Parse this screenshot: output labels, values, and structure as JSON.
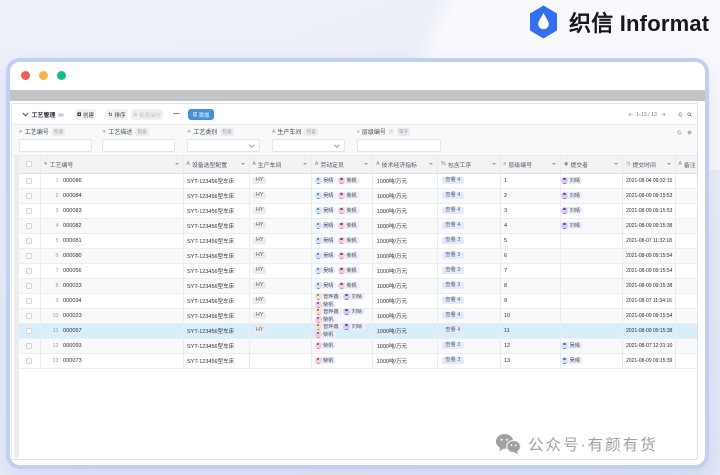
{
  "brand": {
    "name": "织信 Informat",
    "logo_color": "#3370f0"
  },
  "toolbar": {
    "title": "工艺管理",
    "buttons": [
      {
        "label": "创建",
        "icon": "plus-square-icon",
        "disabled": false
      },
      {
        "label": "排序",
        "icon": "sort-icon",
        "disabled": false
      },
      {
        "label": "批量操作",
        "icon": "batch-icon",
        "disabled": true
      }
    ],
    "more_label": "—",
    "add_button": {
      "label": "添加",
      "color": "#4591d9"
    },
    "pagination": {
      "range": "1-13 / 13"
    }
  },
  "filters": [
    {
      "icon": "number-icon",
      "label": "工艺编号",
      "op": "包含",
      "type": "text",
      "value": ""
    },
    {
      "icon": "number-icon",
      "label": "工艺描述",
      "op": "包含",
      "type": "text",
      "value": ""
    },
    {
      "icon": "number-icon",
      "label": "工艺类别",
      "op": "包含",
      "type": "select",
      "value": ""
    },
    {
      "icon": "text-icon",
      "label": "生产车间",
      "op": "包含",
      "type": "select",
      "value": ""
    },
    {
      "icon": "list-icon",
      "label": "层级编号",
      "op": "等于",
      "op_symbol": "=",
      "type": "text",
      "value": ""
    }
  ],
  "table": {
    "columns": [
      {
        "icon": "number-icon",
        "label": "工艺编号"
      },
      {
        "icon": "text-icon",
        "label": "设备选型配置"
      },
      {
        "icon": "text-icon",
        "label": "生产车间"
      },
      {
        "icon": "text-icon",
        "label": "劳动定员"
      },
      {
        "icon": "text-icon",
        "label": "技术经济指标"
      },
      {
        "icon": "link-icon",
        "label": "包含工序"
      },
      {
        "icon": "list-icon",
        "label": "层级编号"
      },
      {
        "icon": "user-icon",
        "label": "提交者"
      },
      {
        "icon": "clock-icon",
        "label": "提交时间"
      },
      {
        "icon": "text-icon",
        "label": "备注"
      }
    ],
    "view_label": "查看",
    "highlighted_row": 11,
    "rows": [
      {
        "num": 1,
        "code": "000086",
        "equipment": "SYT-123456型车床",
        "workshop": "HY",
        "staff": [
          [
            "吴晴",
            "柴帆"
          ]
        ],
        "indicator": "1000吨/万元",
        "view_count": 4,
        "level": 1,
        "submitter": "刘晴",
        "submit_time": "2021-08-04 09:32:15",
        "remark": ""
      },
      {
        "num": 2,
        "code": "000084",
        "equipment": "SYT-123456型车床",
        "workshop": "HY",
        "staff": [
          [
            "吴晴",
            "柴帆"
          ]
        ],
        "indicator": "1000吨/万元",
        "view_count": 4,
        "level": 2,
        "submitter": "刘晴",
        "submit_time": "2021-08-09 09:15:53",
        "remark": ""
      },
      {
        "num": 3,
        "code": "000083",
        "equipment": "SYT-123456型车床",
        "workshop": "HY",
        "staff": [
          [
            "吴晴",
            "柴帆"
          ]
        ],
        "indicator": "1000吨/万元",
        "view_count": 4,
        "level": 3,
        "submitter": "刘晴",
        "submit_time": "2021-08-09 09:15:53",
        "remark": ""
      },
      {
        "num": 4,
        "code": "000082",
        "equipment": "SYT-123456型车床",
        "workshop": "HY",
        "staff": [
          [
            "吴晴",
            "柴帆"
          ]
        ],
        "indicator": "1000吨/万元",
        "view_count": 4,
        "level": 4,
        "submitter": "刘晴",
        "submit_time": "2021-08-09 09:15:38",
        "remark": ""
      },
      {
        "num": 5,
        "code": "000081",
        "equipment": "SYT-123456型车床",
        "workshop": "HY",
        "staff": [
          [
            "吴晴",
            "柴帆"
          ]
        ],
        "indicator": "1000吨/万元",
        "view_count": 3,
        "level": 5,
        "submitter": "",
        "submit_time": "2021-08-07 11:32:18",
        "remark": ""
      },
      {
        "num": 6,
        "code": "000080",
        "equipment": "SYT-123456型车床",
        "workshop": "HY",
        "staff": [
          [
            "吴晴",
            "柴帆"
          ]
        ],
        "indicator": "1000吨/万元",
        "view_count": 3,
        "level": 6,
        "submitter": "",
        "submit_time": "2021-08-09 09:15:54",
        "remark": ""
      },
      {
        "num": 7,
        "code": "000056",
        "equipment": "SYT-123456型车床",
        "workshop": "HY",
        "staff": [
          [
            "吴晴",
            "柴帆"
          ]
        ],
        "indicator": "1000吨/万元",
        "view_count": 3,
        "level": 7,
        "submitter": "",
        "submit_time": "2021-08-09 09:15:54",
        "remark": ""
      },
      {
        "num": 8,
        "code": "000023",
        "equipment": "SYT-123456型车床",
        "workshop": "HY",
        "staff": [
          [
            "吴晴",
            "柴帆"
          ]
        ],
        "indicator": "1000吨/万元",
        "view_count": 3,
        "level": 8,
        "submitter": "",
        "submit_time": "2021-08-09 09:15:38",
        "remark": ""
      },
      {
        "num": 9,
        "code": "000034",
        "equipment": "SYT-123456型车床",
        "workshop": "HY",
        "staff": [
          [
            "曾烨鑫",
            "刘晴"
          ],
          [
            "柴帆"
          ]
        ],
        "indicator": "1000吨/万元",
        "view_count": 4,
        "level": 9,
        "submitter": "",
        "submit_time": "2021-08-07 11:34:16",
        "remark": ""
      },
      {
        "num": 10,
        "code": "000023",
        "equipment": "SYT-123456型车床",
        "workshop": "HY",
        "staff": [
          [
            "曾烨鑫",
            "刘晴"
          ],
          [
            "柴帆"
          ]
        ],
        "indicator": "1000吨/万元",
        "view_count": 4,
        "level": 10,
        "submitter": "",
        "submit_time": "2021-08-09 09:15:54",
        "remark": ""
      },
      {
        "num": 11,
        "code": "000057",
        "equipment": "SYT-123456型车床",
        "workshop": "HY",
        "staff": [
          [
            "曾烨鑫",
            "刘晴"
          ],
          [
            "柴帆"
          ]
        ],
        "indicator": "1000吨/万元",
        "view_count": 4,
        "level": 11,
        "submitter": "",
        "submit_time": "2021-08-09 09:15:38",
        "remark": ""
      },
      {
        "num": 12,
        "code": "000093",
        "equipment": "SYT-123456型车床",
        "workshop": "",
        "staff": [
          [
            "柴帆"
          ]
        ],
        "indicator": "1000吨/万元",
        "view_count": 3,
        "level": 12,
        "submitter": "吴晴",
        "submit_time": "2021-08-07 12:31:10",
        "remark": ""
      },
      {
        "num": 13,
        "code": "000073",
        "equipment": "SYT-123456型车床",
        "workshop": "",
        "staff": [
          [
            "柴帆"
          ]
        ],
        "indicator": "1000吨/万元",
        "view_count": 3,
        "level": 13,
        "submitter": "吴晴",
        "submit_time": "2021-08-09 09:15:39",
        "remark": ""
      }
    ]
  },
  "people": {
    "吴晴": {
      "bg": "#cfe6fa",
      "hair": "#4a5480",
      "body": "#5585e6"
    },
    "柴帆": {
      "bg": "#f8cbd9",
      "hair": "#3c4370",
      "body": "#ee6fae"
    },
    "刘晴": {
      "bg": "#ddc7f6",
      "hair": "#483a7a",
      "body": "#8f5ce8"
    },
    "曾烨鑫": {
      "bg": "#fce2c2",
      "hair": "#7a4e2a",
      "body": "#5585e6"
    }
  },
  "watermark": {
    "text": "公众号·有颜有货"
  }
}
